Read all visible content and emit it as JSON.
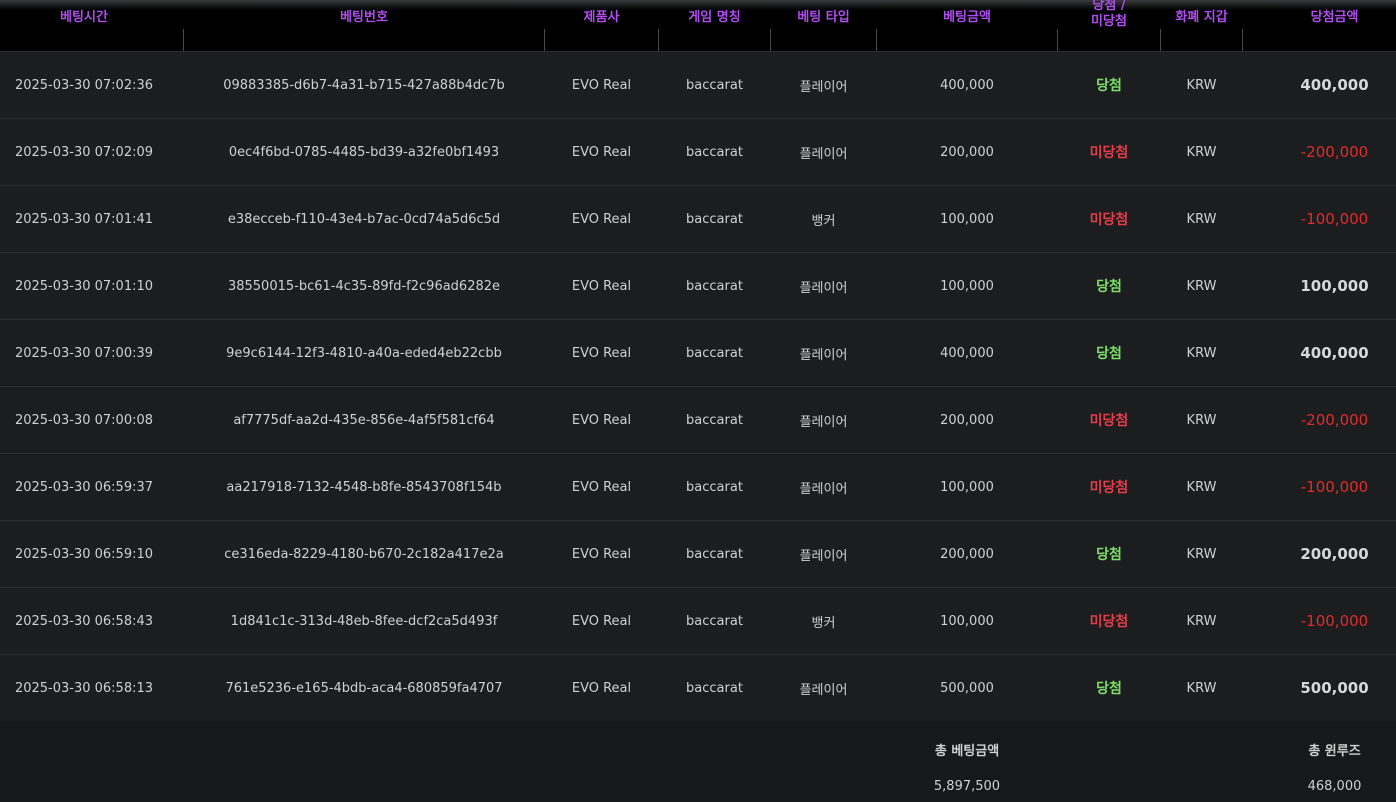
{
  "headers": {
    "time": "베팅시간",
    "bet_id": "베팅번호",
    "provider": "제품사",
    "game": "게임 명칭",
    "bet_type": "베팅 타입",
    "amount": "베팅금액",
    "result_line1": "당첨 /",
    "result_line2": "미당첨",
    "wallet": "화폐 지갑",
    "payout": "당첨금액"
  },
  "rows": [
    {
      "time": "2025-03-30 07:02:36",
      "bet_id": "09883385-d6b7-4a31-b715-427a88b4dc7b",
      "provider": "EVO Real",
      "game": "baccarat",
      "bet_type": "플레이어",
      "amount": "400,000",
      "status": "당첨",
      "wallet": "KRW",
      "payout": "400,000"
    },
    {
      "time": "2025-03-30 07:02:09",
      "bet_id": "0ec4f6bd-0785-4485-bd39-a32fe0bf1493",
      "provider": "EVO Real",
      "game": "baccarat",
      "bet_type": "플레이어",
      "amount": "200,000",
      "status": "미당첨",
      "wallet": "KRW",
      "payout": "-200,000"
    },
    {
      "time": "2025-03-30 07:01:41",
      "bet_id": "e38ecceb-f110-43e4-b7ac-0cd74a5d6c5d",
      "provider": "EVO Real",
      "game": "baccarat",
      "bet_type": "뱅커",
      "amount": "100,000",
      "status": "미당첨",
      "wallet": "KRW",
      "payout": "-100,000"
    },
    {
      "time": "2025-03-30 07:01:10",
      "bet_id": "38550015-bc61-4c35-89fd-f2c96ad6282e",
      "provider": "EVO Real",
      "game": "baccarat",
      "bet_type": "플레이어",
      "amount": "100,000",
      "status": "당첨",
      "wallet": "KRW",
      "payout": "100,000"
    },
    {
      "time": "2025-03-30 07:00:39",
      "bet_id": "9e9c6144-12f3-4810-a40a-eded4eb22cbb",
      "provider": "EVO Real",
      "game": "baccarat",
      "bet_type": "플레이어",
      "amount": "400,000",
      "status": "당첨",
      "wallet": "KRW",
      "payout": "400,000"
    },
    {
      "time": "2025-03-30 07:00:08",
      "bet_id": "af7775df-aa2d-435e-856e-4af5f581cf64",
      "provider": "EVO Real",
      "game": "baccarat",
      "bet_type": "플레이어",
      "amount": "200,000",
      "status": "미당첨",
      "wallet": "KRW",
      "payout": "-200,000"
    },
    {
      "time": "2025-03-30 06:59:37",
      "bet_id": "aa217918-7132-4548-b8fe-8543708f154b",
      "provider": "EVO Real",
      "game": "baccarat",
      "bet_type": "플레이어",
      "amount": "100,000",
      "status": "미당첨",
      "wallet": "KRW",
      "payout": "-100,000"
    },
    {
      "time": "2025-03-30 06:59:10",
      "bet_id": "ce316eda-8229-4180-b670-2c182a417e2a",
      "provider": "EVO Real",
      "game": "baccarat",
      "bet_type": "플레이어",
      "amount": "200,000",
      "status": "당첨",
      "wallet": "KRW",
      "payout": "200,000"
    },
    {
      "time": "2025-03-30 06:58:43",
      "bet_id": "1d841c1c-313d-48eb-8fee-dcf2ca5d493f",
      "provider": "EVO Real",
      "game": "baccarat",
      "bet_type": "뱅커",
      "amount": "100,000",
      "status": "미당첨",
      "wallet": "KRW",
      "payout": "-100,000"
    },
    {
      "time": "2025-03-30 06:58:13",
      "bet_id": "761e5236-e165-4bdb-aca4-680859fa4707",
      "provider": "EVO Real",
      "game": "baccarat",
      "bet_type": "플레이어",
      "amount": "500,000",
      "status": "당첨",
      "wallet": "KRW",
      "payout": "500,000"
    }
  ],
  "footer": {
    "total_bet_label": "총 베팅금액",
    "total_bet_value": "5,897,500",
    "total_winloss_label": "총 윈루즈",
    "total_winloss_value": "468,000"
  },
  "colors": {
    "header_text": "#b04cf0",
    "win": "#7ede6a",
    "lose": "#e33d4b",
    "negative_payout": "#e12c2c"
  }
}
